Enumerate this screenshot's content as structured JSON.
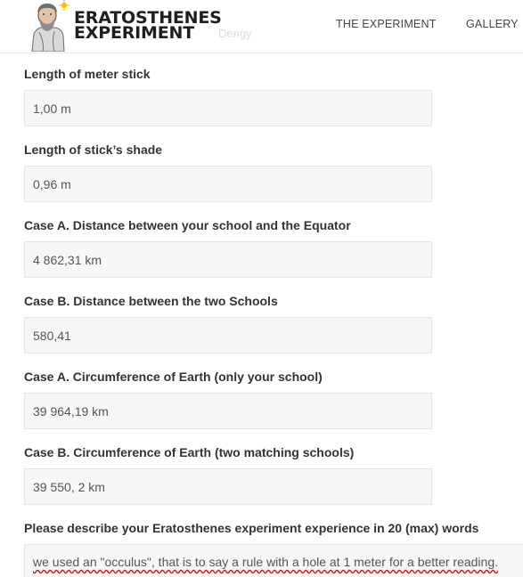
{
  "header": {
    "logo_line1": "ERATOSTHENES",
    "logo_line2": "EXPERIMENT",
    "ghost_text": "Dengy",
    "nav": [
      {
        "label": "THE EXPERIMENT"
      },
      {
        "label": "GALLERY"
      }
    ]
  },
  "form": {
    "fields": [
      {
        "label": "Length of meter stick",
        "value": "1,00 m"
      },
      {
        "label": "Length of stick’s shade",
        "value": "0,96 m"
      },
      {
        "label": "Case A. Distance between your school and the Equator",
        "value": "4 862,31 km"
      },
      {
        "label": "Case B. Distance between the two Schools",
        "value": "580,41"
      },
      {
        "label": "Case A. Circumference of Earth (only your school)",
        "value": "39 964,19 km"
      },
      {
        "label": "Case B. Circumference of Earth (two matching schools)",
        "value": "39 550, 2 km"
      },
      {
        "label": "Please describe your Eratosthenes experiment experience in 20 (max) words",
        "value": "we used an \"occulus\", that is to say a rule with a hole at 1 meter for a better reading."
      }
    ]
  },
  "colors": {
    "input_bg": "#f7f7f7",
    "input_border": "#e6e6e6",
    "label_text": "#333333",
    "spellcheck_underline": "#dd1111"
  }
}
